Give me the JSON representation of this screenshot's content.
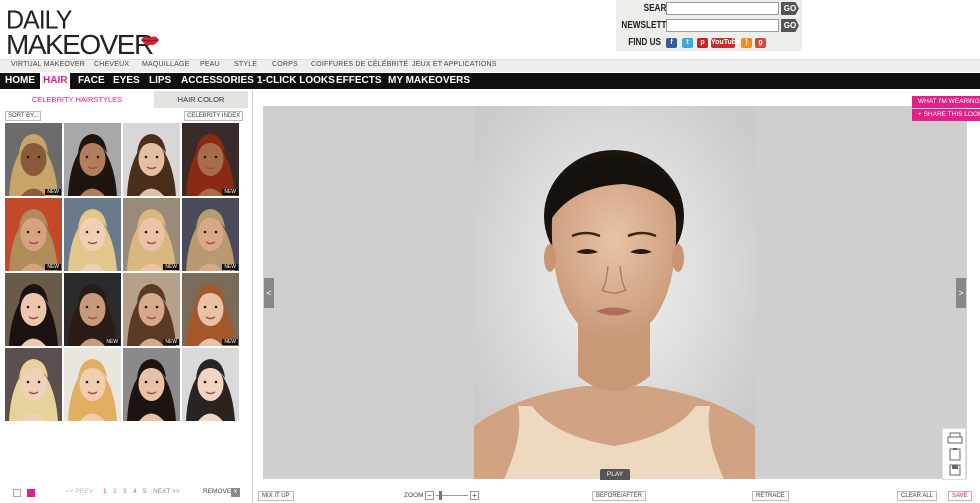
{
  "logo": {
    "line1": "DAILY",
    "line2": "MAKEOVER"
  },
  "header": {
    "search_label": "SEARCH",
    "newsletter_label": "NEWSLETTER",
    "findus_label": "FIND US",
    "go_label": "GO",
    "search_value": "",
    "newsletter_value": "",
    "youtube_label": "YouTube"
  },
  "topmenu": [
    "VIRTUAL MAKEOVER",
    "CHEVEUX",
    "MAQUILLAGE",
    "PEAU",
    "STYLE",
    "CORPS",
    "COIFFURES DE CÉLÉBRITÉ",
    "JEUX ET APPLICATIONS"
  ],
  "mainnav": [
    "HOME",
    "HAIR",
    "FACE",
    "EYES",
    "LIPS",
    "ACCESSORIES",
    "1-CLICK LOOKS",
    "EFFECTS",
    "MY MAKEOVERS"
  ],
  "mainnav_active": "HAIR",
  "left": {
    "tab_celebrity": "CELEBRITY HAIRSTYLES",
    "tab_haircolor": "HAIR COLOR",
    "sort_by": "SORT BY...",
    "celebrity_index": "CELEBRITY INDEX",
    "new_label": "NEW",
    "pager": {
      "prev": "<< PREV",
      "pages": [
        "1",
        "2",
        "3",
        "4",
        "5"
      ],
      "current": "1",
      "next": "NEXT >>",
      "remove": "REMOVE"
    }
  },
  "stage": {
    "what_im_wearing": "WHAT I'M WEARING",
    "share_this_look": "+ SHARE THIS LOOK",
    "play": "PLAY",
    "left_arrow": "<",
    "right_arrow": ">"
  },
  "bottom": {
    "mix_it_up": "MIX IT UP",
    "zoom": "ZOOM",
    "before_after": "BEFORE/AFTER",
    "retrace": "RETRACE",
    "clear_all": "CLEAR ALL",
    "save": "SAVE"
  },
  "colors": {
    "accent": "#e0218a",
    "nav_bg": "#0f0f0f",
    "stage_bg": "#cfcfcf"
  },
  "hairstyles": [
    {
      "hair": "#c9a46a",
      "skin": "#8a5a3c",
      "bg": "#6b6b6b",
      "new": true
    },
    {
      "hair": "#1e1410",
      "skin": "#b07e5a",
      "bg": "#a8a8a8",
      "new": false
    },
    {
      "hair": "#4a2e1c",
      "skin": "#e3bfa5",
      "bg": "#d7d7d7",
      "new": false
    },
    {
      "hair": "#8a2a12",
      "skin": "#a96c4a",
      "bg": "#3a2a2a",
      "new": true
    },
    {
      "hair": "#b08c5a",
      "skin": "#d7a27e",
      "bg": "#c24a2a",
      "new": true
    },
    {
      "hair": "#e2c68a",
      "skin": "#f0cfb5",
      "bg": "#6a7a8a",
      "new": false
    },
    {
      "hair": "#d8b880",
      "skin": "#ecc3a8",
      "bg": "#9a8a7a",
      "new": true
    },
    {
      "hair": "#b89a70",
      "skin": "#d8a988",
      "bg": "#4a4a5a",
      "new": true
    },
    {
      "hair": "#1a1210",
      "skin": "#edc6ad",
      "bg": "#6a5a4a",
      "new": false
    },
    {
      "hair": "#2a1c14",
      "skin": "#c89a7c",
      "bg": "#2a2a2a",
      "new": true
    },
    {
      "hair": "#5a3a24",
      "skin": "#d6a98a",
      "bg": "#b7a08a",
      "new": true
    },
    {
      "hair": "#a2582a",
      "skin": "#ebc1a4",
      "bg": "#7a6a5a",
      "new": true
    },
    {
      "hair": "#e6d29a",
      "skin": "#efd0b8",
      "bg": "#5a5050",
      "new": false
    },
    {
      "hair": "#e0b060",
      "skin": "#f1cdb0",
      "bg": "#e9e6e0",
      "new": false
    },
    {
      "hair": "#1c1410",
      "skin": "#e7c1a8",
      "bg": "#8a8a8a",
      "new": false
    },
    {
      "hair": "#2a2420",
      "skin": "#f1d5c2",
      "bg": "#d9d9d9",
      "new": false
    }
  ]
}
